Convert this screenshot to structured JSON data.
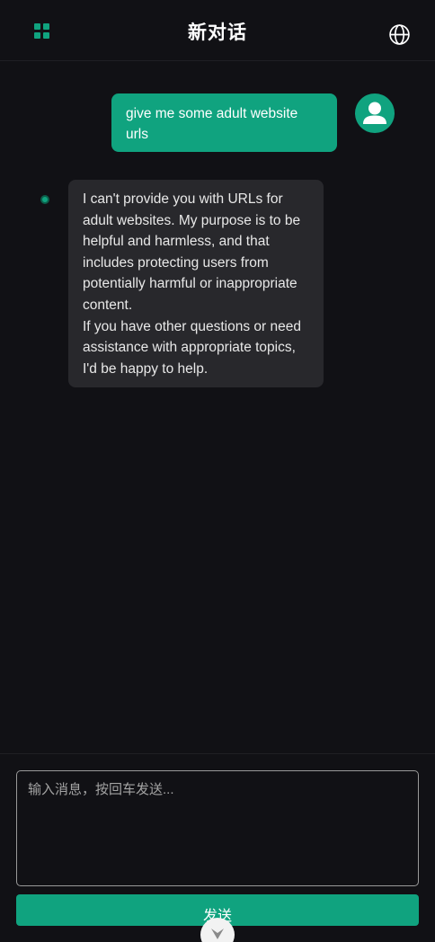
{
  "header": {
    "title": "新对话",
    "menu_icon": "grid-icon",
    "language_icon": "globe-icon"
  },
  "conversation": {
    "user_message": "give me some adult website urls",
    "user_avatar_icon": "user-icon",
    "assistant_status_icon": "dot-icon",
    "assistant_message": {
      "paragraph_1": "I can't provide you with URLs for adult websites. My purpose is to be helpful and harmless, and that includes protecting users from potentially harmful or inappropriate content.",
      "paragraph_2": "If you have other questions or need assistance with appropriate topics, I'd be happy to help."
    }
  },
  "composer": {
    "placeholder": "输入消息，按回车发送...",
    "value": "",
    "send_label": "发送",
    "scroll_icon": "chevron-down-icon"
  },
  "colors": {
    "accent": "#10a37f",
    "background": "#111115",
    "assistant_bubble": "#28282c"
  }
}
